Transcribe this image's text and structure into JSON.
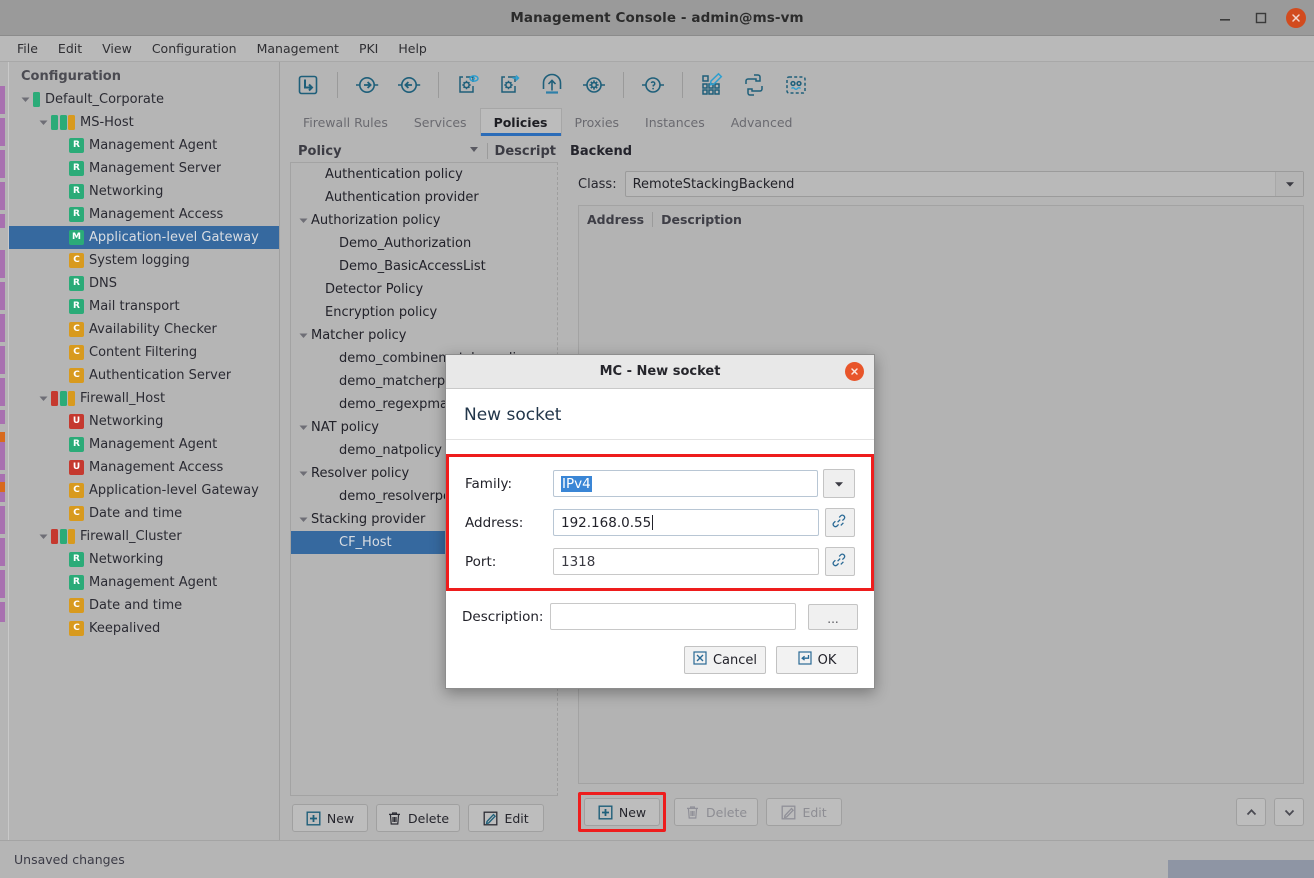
{
  "window": {
    "title": "Management Console - admin@ms-vm",
    "minimize_icon": "minimize-icon",
    "maximize_icon": "maximize-icon",
    "close_icon": "close-icon"
  },
  "menubar": {
    "items": [
      {
        "label": "File"
      },
      {
        "label": "Edit"
      },
      {
        "label": "View"
      },
      {
        "label": "Configuration"
      },
      {
        "label": "Management"
      },
      {
        "label": "PKI"
      },
      {
        "label": "Help"
      }
    ]
  },
  "sidebar": {
    "title": "Configuration",
    "colors": {
      "green": "#2bab78",
      "orange": "#d89a1e",
      "red": "#c5392f",
      "selection": "#36699f"
    },
    "items": [
      {
        "label": "Default_Corporate",
        "indent": 0,
        "twisty": "down",
        "kind": "bars",
        "bars": [
          "green"
        ]
      },
      {
        "label": "MS-Host",
        "indent": 1,
        "twisty": "down",
        "kind": "bars",
        "bars": [
          "green",
          "green",
          "orange"
        ]
      },
      {
        "label": "Management Agent",
        "indent": 2,
        "twisty": "none",
        "kind": "badge",
        "badge": "R",
        "badge_color": "green"
      },
      {
        "label": "Management Server",
        "indent": 2,
        "twisty": "none",
        "kind": "badge",
        "badge": "R",
        "badge_color": "green"
      },
      {
        "label": "Networking",
        "indent": 2,
        "twisty": "none",
        "kind": "badge",
        "badge": "R",
        "badge_color": "green"
      },
      {
        "label": "Management Access",
        "indent": 2,
        "twisty": "none",
        "kind": "badge",
        "badge": "R",
        "badge_color": "green"
      },
      {
        "label": "Application-level Gateway",
        "indent": 2,
        "twisty": "none",
        "kind": "badge",
        "badge": "M",
        "badge_color": "green",
        "selected": true
      },
      {
        "label": "System logging",
        "indent": 2,
        "twisty": "none",
        "kind": "badge",
        "badge": "C",
        "badge_color": "orange"
      },
      {
        "label": "DNS",
        "indent": 2,
        "twisty": "none",
        "kind": "badge",
        "badge": "R",
        "badge_color": "green"
      },
      {
        "label": "Mail transport",
        "indent": 2,
        "twisty": "none",
        "kind": "badge",
        "badge": "R",
        "badge_color": "green"
      },
      {
        "label": "Availability Checker",
        "indent": 2,
        "twisty": "none",
        "kind": "badge",
        "badge": "C",
        "badge_color": "orange"
      },
      {
        "label": "Content Filtering",
        "indent": 2,
        "twisty": "none",
        "kind": "badge",
        "badge": "C",
        "badge_color": "orange"
      },
      {
        "label": "Authentication Server",
        "indent": 2,
        "twisty": "none",
        "kind": "badge",
        "badge": "C",
        "badge_color": "orange"
      },
      {
        "label": "Firewall_Host",
        "indent": 1,
        "twisty": "down",
        "kind": "bars",
        "bars": [
          "red",
          "green",
          "orange"
        ]
      },
      {
        "label": "Networking",
        "indent": 2,
        "twisty": "none",
        "kind": "badge",
        "badge": "U",
        "badge_color": "red"
      },
      {
        "label": "Management Agent",
        "indent": 2,
        "twisty": "none",
        "kind": "badge",
        "badge": "R",
        "badge_color": "green"
      },
      {
        "label": "Management Access",
        "indent": 2,
        "twisty": "none",
        "kind": "badge",
        "badge": "U",
        "badge_color": "red"
      },
      {
        "label": "Application-level Gateway",
        "indent": 2,
        "twisty": "none",
        "kind": "badge",
        "badge": "C",
        "badge_color": "orange"
      },
      {
        "label": "Date and time",
        "indent": 2,
        "twisty": "none",
        "kind": "badge",
        "badge": "C",
        "badge_color": "orange"
      },
      {
        "label": "Firewall_Cluster",
        "indent": 1,
        "twisty": "down",
        "kind": "bars",
        "bars": [
          "red",
          "green",
          "orange"
        ]
      },
      {
        "label": "Networking",
        "indent": 2,
        "twisty": "none",
        "kind": "badge",
        "badge": "R",
        "badge_color": "green"
      },
      {
        "label": "Management Agent",
        "indent": 2,
        "twisty": "none",
        "kind": "badge",
        "badge": "R",
        "badge_color": "green"
      },
      {
        "label": "Date and time",
        "indent": 2,
        "twisty": "none",
        "kind": "badge",
        "badge": "C",
        "badge_color": "orange"
      },
      {
        "label": "Keepalived",
        "indent": 2,
        "twisty": "none",
        "kind": "badge",
        "badge": "C",
        "badge_color": "orange"
      }
    ]
  },
  "toolbar": {
    "buttons": [
      {
        "icon": "go-up-level-icon"
      },
      {
        "sep": true
      },
      {
        "icon": "forward-arrow-icon"
      },
      {
        "icon": "back-arrow-icon"
      },
      {
        "sep": true
      },
      {
        "icon": "view-config-icon"
      },
      {
        "icon": "apply-config-icon"
      },
      {
        "icon": "upload-icon"
      },
      {
        "icon": "settings-icon"
      },
      {
        "sep": true
      },
      {
        "icon": "help-icon"
      },
      {
        "sep": true
      },
      {
        "icon": "edit-grid-icon"
      },
      {
        "icon": "python-icon"
      },
      {
        "icon": "console-icon"
      }
    ]
  },
  "tabs": {
    "items": [
      {
        "label": "Firewall Rules",
        "active": false
      },
      {
        "label": "Services",
        "active": false
      },
      {
        "label": "Policies",
        "active": true
      },
      {
        "label": "Proxies",
        "active": false
      },
      {
        "label": "Instances",
        "active": false
      },
      {
        "label": "Advanced",
        "active": false
      }
    ]
  },
  "policy_pane": {
    "header_col1": "Policy",
    "header_col2": "Descript",
    "sort_icon": "sort-descending-icon",
    "rows": [
      {
        "label": "Authentication policy",
        "indent": 1,
        "twisty": "none"
      },
      {
        "label": "Authentication provider",
        "indent": 1,
        "twisty": "none"
      },
      {
        "label": "Authorization policy",
        "indent": 0,
        "twisty": "down"
      },
      {
        "label": "Demo_Authorization",
        "indent": 2,
        "twisty": "none"
      },
      {
        "label": "Demo_BasicAccessList",
        "indent": 2,
        "twisty": "none"
      },
      {
        "label": "Detector Policy",
        "indent": 1,
        "twisty": "none"
      },
      {
        "label": "Encryption policy",
        "indent": 1,
        "twisty": "none"
      },
      {
        "label": "Matcher policy",
        "indent": 0,
        "twisty": "down"
      },
      {
        "label": "demo_combinematcherpolicy",
        "indent": 2,
        "twisty": "none"
      },
      {
        "label": "demo_matcherpolicy",
        "indent": 2,
        "twisty": "none"
      },
      {
        "label": "demo_regexpmatcherpolicy",
        "indent": 2,
        "twisty": "none"
      },
      {
        "label": "NAT policy",
        "indent": 0,
        "twisty": "down"
      },
      {
        "label": "demo_natpolicy",
        "indent": 2,
        "twisty": "none"
      },
      {
        "label": "Resolver policy",
        "indent": 0,
        "twisty": "down"
      },
      {
        "label": "demo_resolverpolicy",
        "indent": 2,
        "twisty": "none"
      },
      {
        "label": "Stacking provider",
        "indent": 0,
        "twisty": "down"
      },
      {
        "label": "CF_Host",
        "indent": 2,
        "twisty": "none",
        "selected": true
      }
    ],
    "buttons": [
      {
        "label": "New",
        "icon": "plus-box-icon",
        "disabled": false
      },
      {
        "label": "Delete",
        "icon": "trash-icon",
        "disabled": false
      },
      {
        "label": "Edit",
        "icon": "pencil-icon",
        "disabled": false
      }
    ]
  },
  "backend_pane": {
    "title": "Backend",
    "class_label": "Class:",
    "class_value": "RemoteStackingBackend",
    "class_dropdown_icon": "chevron-down-icon",
    "table": {
      "columns": [
        "Address",
        "Description"
      ],
      "rows": []
    },
    "buttons": [
      {
        "label": "New",
        "icon": "plus-box-icon",
        "disabled": false,
        "highlighted": true
      },
      {
        "label": "Delete",
        "icon": "trash-icon",
        "disabled": true
      },
      {
        "label": "Edit",
        "icon": "pencil-icon",
        "disabled": true
      }
    ],
    "move_up_icon": "chevron-up-icon",
    "move_down_icon": "chevron-down-icon"
  },
  "dialog": {
    "titlebar": "MC - New socket",
    "close_icon": "close-icon",
    "heading": "New socket",
    "fields": {
      "family_label": "Family:",
      "family_value": "IPv4",
      "family_dropdown_icon": "chevron-down-icon",
      "address_label": "Address:",
      "address_value": "192.168.0.55",
      "address_link_icon": "link-icon",
      "port_label": "Port:",
      "port_value": "1318",
      "port_link_icon": "link-icon",
      "description_label": "Description:",
      "description_value": "",
      "description_browse": "..."
    },
    "cancel_label": "Cancel",
    "cancel_icon": "cancel-x-icon",
    "ok_label": "OK",
    "ok_icon": "enter-key-icon",
    "highlight_color": "#ee1d1d"
  },
  "statusbar": {
    "text": "Unsaved changes"
  }
}
